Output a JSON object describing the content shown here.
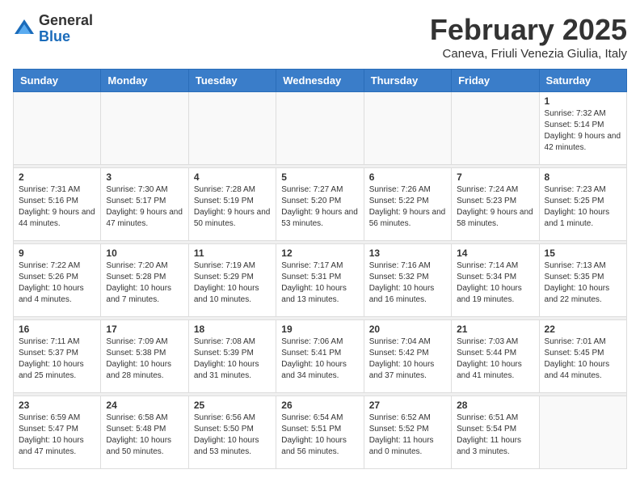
{
  "header": {
    "logo_general": "General",
    "logo_blue": "Blue",
    "month_title": "February 2025",
    "location": "Caneva, Friuli Venezia Giulia, Italy"
  },
  "weekdays": [
    "Sunday",
    "Monday",
    "Tuesday",
    "Wednesday",
    "Thursday",
    "Friday",
    "Saturday"
  ],
  "weeks": [
    [
      {
        "day": "",
        "info": ""
      },
      {
        "day": "",
        "info": ""
      },
      {
        "day": "",
        "info": ""
      },
      {
        "day": "",
        "info": ""
      },
      {
        "day": "",
        "info": ""
      },
      {
        "day": "",
        "info": ""
      },
      {
        "day": "1",
        "info": "Sunrise: 7:32 AM\nSunset: 5:14 PM\nDaylight: 9 hours and 42 minutes."
      }
    ],
    [
      {
        "day": "2",
        "info": "Sunrise: 7:31 AM\nSunset: 5:16 PM\nDaylight: 9 hours and 44 minutes."
      },
      {
        "day": "3",
        "info": "Sunrise: 7:30 AM\nSunset: 5:17 PM\nDaylight: 9 hours and 47 minutes."
      },
      {
        "day": "4",
        "info": "Sunrise: 7:28 AM\nSunset: 5:19 PM\nDaylight: 9 hours and 50 minutes."
      },
      {
        "day": "5",
        "info": "Sunrise: 7:27 AM\nSunset: 5:20 PM\nDaylight: 9 hours and 53 minutes."
      },
      {
        "day": "6",
        "info": "Sunrise: 7:26 AM\nSunset: 5:22 PM\nDaylight: 9 hours and 56 minutes."
      },
      {
        "day": "7",
        "info": "Sunrise: 7:24 AM\nSunset: 5:23 PM\nDaylight: 9 hours and 58 minutes."
      },
      {
        "day": "8",
        "info": "Sunrise: 7:23 AM\nSunset: 5:25 PM\nDaylight: 10 hours and 1 minute."
      }
    ],
    [
      {
        "day": "9",
        "info": "Sunrise: 7:22 AM\nSunset: 5:26 PM\nDaylight: 10 hours and 4 minutes."
      },
      {
        "day": "10",
        "info": "Sunrise: 7:20 AM\nSunset: 5:28 PM\nDaylight: 10 hours and 7 minutes."
      },
      {
        "day": "11",
        "info": "Sunrise: 7:19 AM\nSunset: 5:29 PM\nDaylight: 10 hours and 10 minutes."
      },
      {
        "day": "12",
        "info": "Sunrise: 7:17 AM\nSunset: 5:31 PM\nDaylight: 10 hours and 13 minutes."
      },
      {
        "day": "13",
        "info": "Sunrise: 7:16 AM\nSunset: 5:32 PM\nDaylight: 10 hours and 16 minutes."
      },
      {
        "day": "14",
        "info": "Sunrise: 7:14 AM\nSunset: 5:34 PM\nDaylight: 10 hours and 19 minutes."
      },
      {
        "day": "15",
        "info": "Sunrise: 7:13 AM\nSunset: 5:35 PM\nDaylight: 10 hours and 22 minutes."
      }
    ],
    [
      {
        "day": "16",
        "info": "Sunrise: 7:11 AM\nSunset: 5:37 PM\nDaylight: 10 hours and 25 minutes."
      },
      {
        "day": "17",
        "info": "Sunrise: 7:09 AM\nSunset: 5:38 PM\nDaylight: 10 hours and 28 minutes."
      },
      {
        "day": "18",
        "info": "Sunrise: 7:08 AM\nSunset: 5:39 PM\nDaylight: 10 hours and 31 minutes."
      },
      {
        "day": "19",
        "info": "Sunrise: 7:06 AM\nSunset: 5:41 PM\nDaylight: 10 hours and 34 minutes."
      },
      {
        "day": "20",
        "info": "Sunrise: 7:04 AM\nSunset: 5:42 PM\nDaylight: 10 hours and 37 minutes."
      },
      {
        "day": "21",
        "info": "Sunrise: 7:03 AM\nSunset: 5:44 PM\nDaylight: 10 hours and 41 minutes."
      },
      {
        "day": "22",
        "info": "Sunrise: 7:01 AM\nSunset: 5:45 PM\nDaylight: 10 hours and 44 minutes."
      }
    ],
    [
      {
        "day": "23",
        "info": "Sunrise: 6:59 AM\nSunset: 5:47 PM\nDaylight: 10 hours and 47 minutes."
      },
      {
        "day": "24",
        "info": "Sunrise: 6:58 AM\nSunset: 5:48 PM\nDaylight: 10 hours and 50 minutes."
      },
      {
        "day": "25",
        "info": "Sunrise: 6:56 AM\nSunset: 5:50 PM\nDaylight: 10 hours and 53 minutes."
      },
      {
        "day": "26",
        "info": "Sunrise: 6:54 AM\nSunset: 5:51 PM\nDaylight: 10 hours and 56 minutes."
      },
      {
        "day": "27",
        "info": "Sunrise: 6:52 AM\nSunset: 5:52 PM\nDaylight: 11 hours and 0 minutes."
      },
      {
        "day": "28",
        "info": "Sunrise: 6:51 AM\nSunset: 5:54 PM\nDaylight: 11 hours and 3 minutes."
      },
      {
        "day": "",
        "info": ""
      }
    ]
  ]
}
